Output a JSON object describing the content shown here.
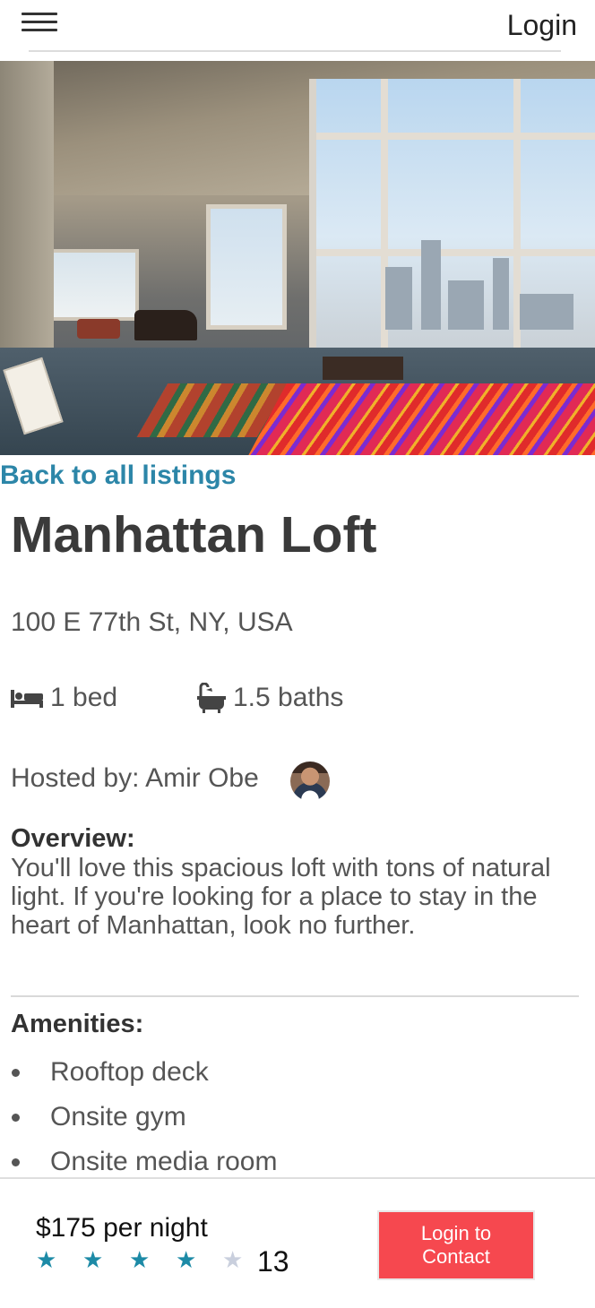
{
  "header": {
    "menu_icon": "hamburger-menu-icon",
    "login_label": "Login"
  },
  "hero": {
    "image_alt": "loft-interior-photo"
  },
  "listing": {
    "back_link": "Back to all listings",
    "title": "Manhattan Loft",
    "address": "100 E 77th St, NY, USA",
    "beds": "1 bed",
    "baths": "1.5 baths",
    "bed_icon": "bed-icon",
    "bath_icon": "bathtub-icon",
    "host_label": "Hosted by: Amir Obe",
    "overview_label": "Overview:",
    "overview_text": "You'll love this spacious loft with tons of natural light. If you're looking for a place to stay in the heart of Manhattan, look no further.",
    "amenities_label": "Amenities:",
    "amenities": [
      "Rooftop deck",
      "Onsite gym",
      "Onsite media room"
    ]
  },
  "booking": {
    "price": "$175 per night",
    "rating": 4,
    "rating_max": 5,
    "review_count": "13",
    "contact_button": "Login to Contact"
  },
  "colors": {
    "link": "#2c86a8",
    "star_filled": "#1c8aa6",
    "star_empty": "#c9cfdd",
    "button": "#f6484f"
  }
}
